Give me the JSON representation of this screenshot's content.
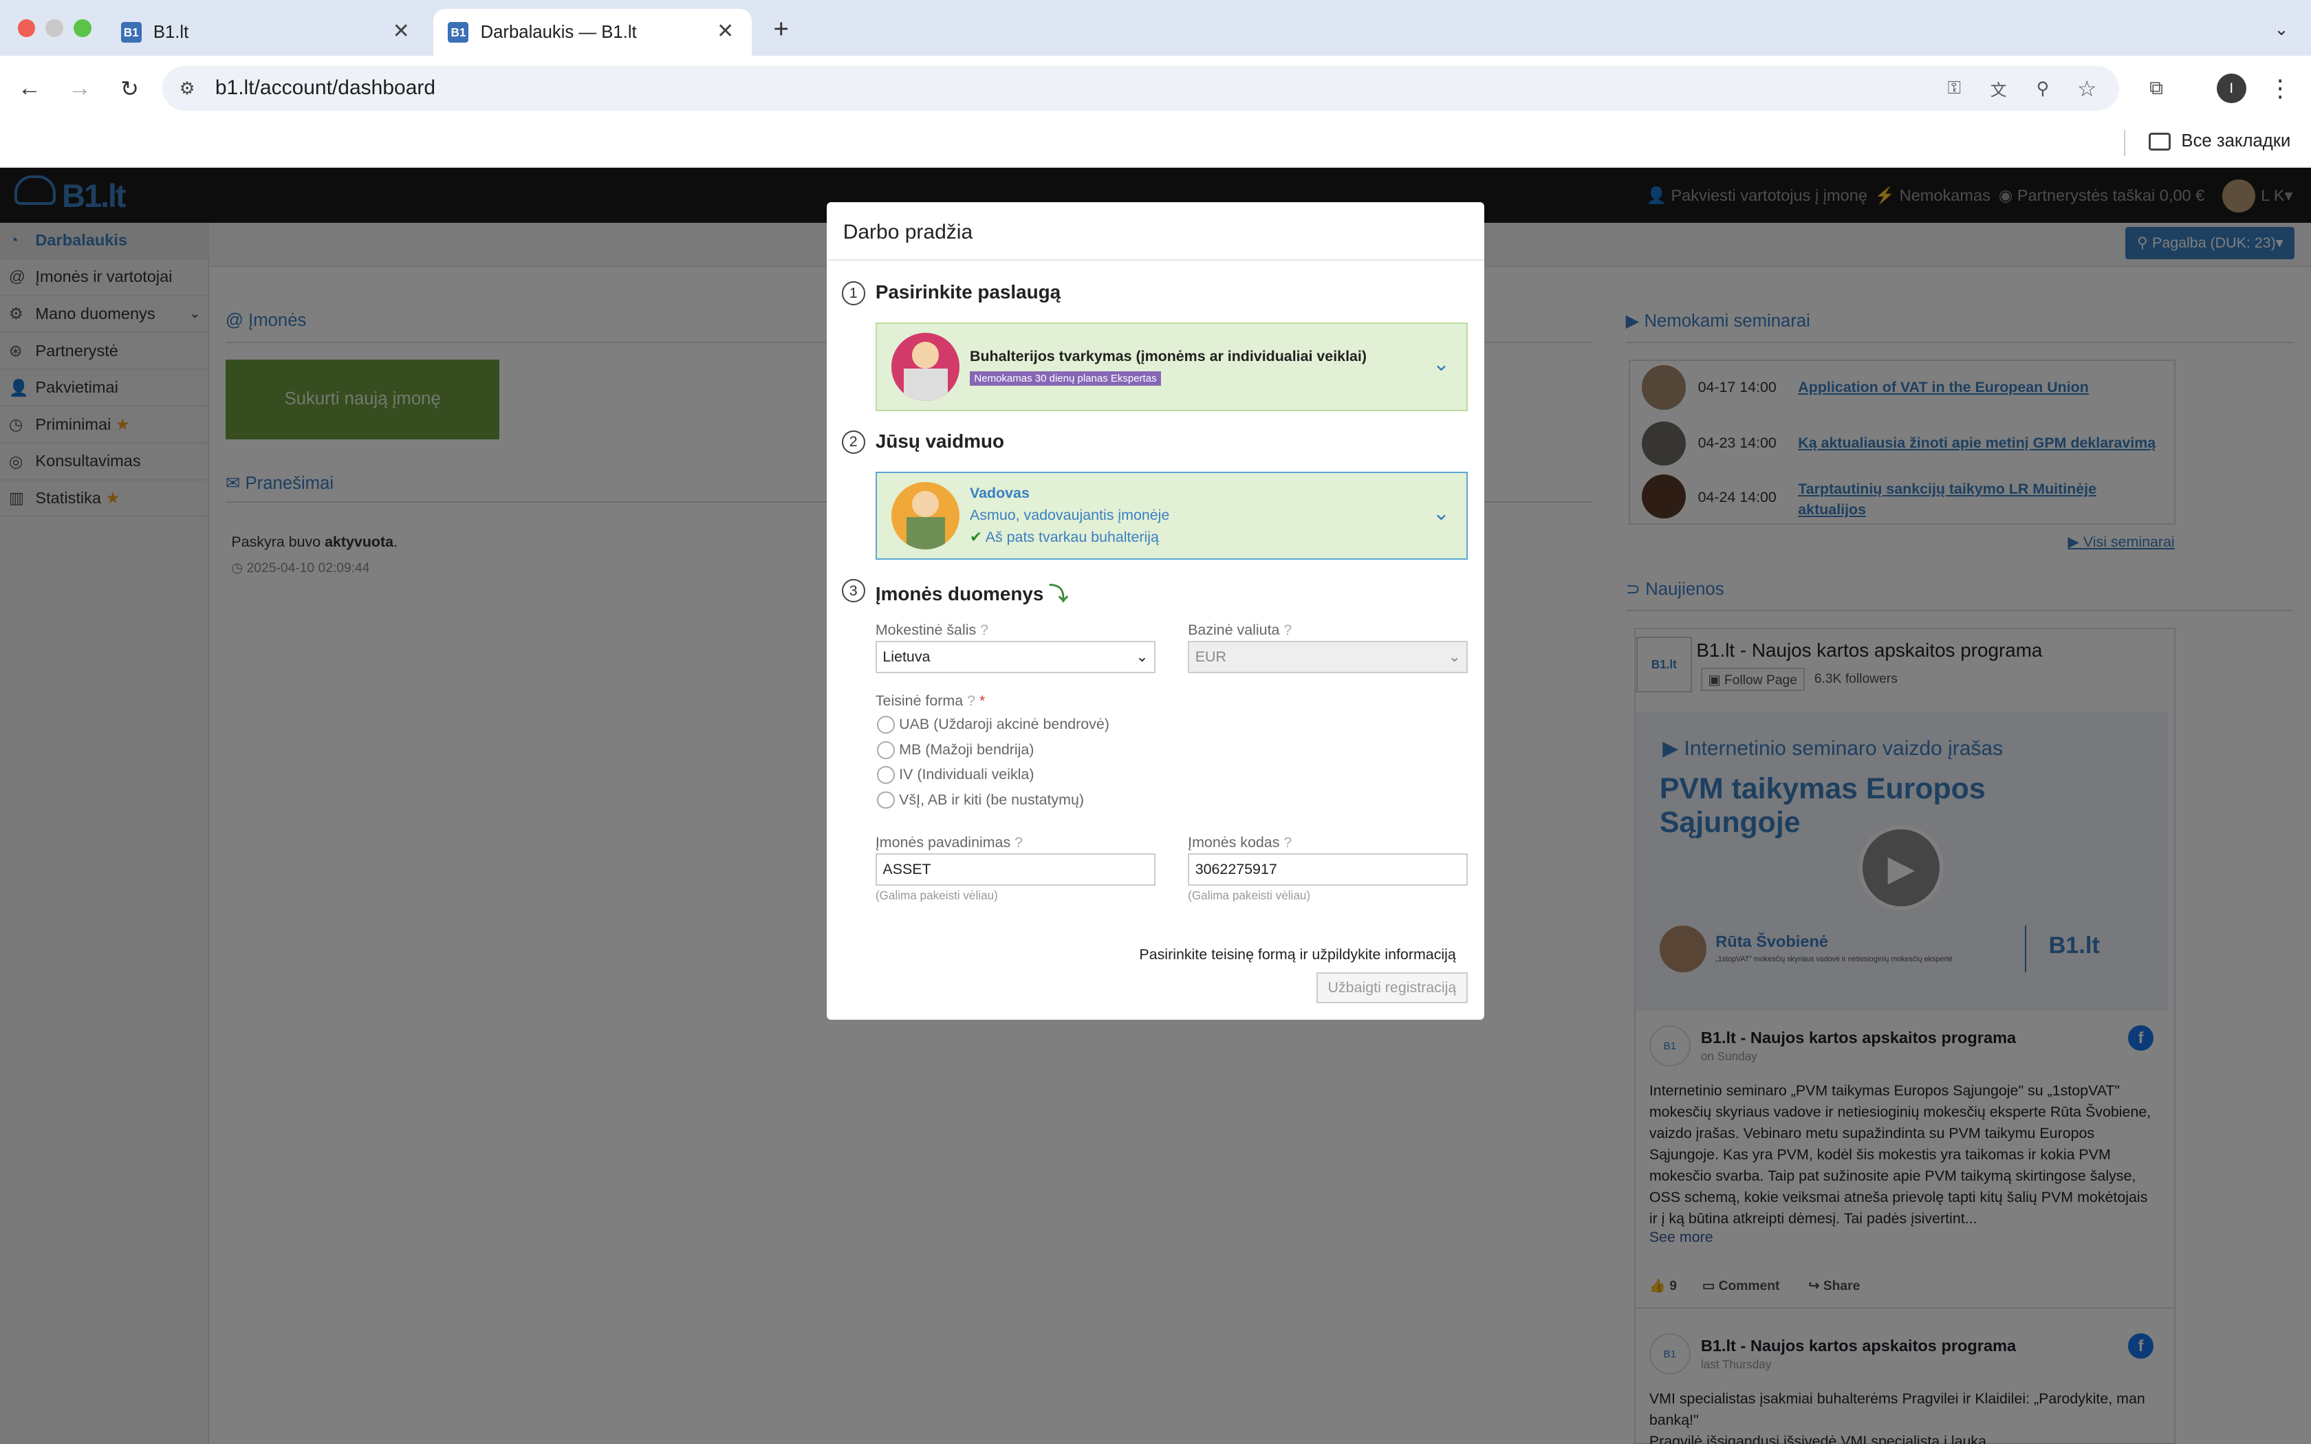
{
  "browser": {
    "tabs": [
      {
        "label": "B1.lt",
        "favicon": "B1"
      },
      {
        "label": "Darbalaukis — B1.lt",
        "favicon": "B1"
      }
    ],
    "url": "b1.lt/account/dashboard",
    "bookmarks_label": "Все закладки",
    "profile_initial": "I"
  },
  "topnav": {
    "logo": "B1.lt",
    "invite": "Pakviesti vartotojus į įmonę",
    "plan": "Nemokamas",
    "points": "Partnerystės taškai 0,00 €",
    "user": "L K",
    "help": "Pagalba (DUK: 23)"
  },
  "sidebar": {
    "items": [
      {
        "label": "Darbalaukis",
        "icon": "dashboard-icon"
      },
      {
        "label": "Įmonės ir vartotojai",
        "icon": "at-icon"
      },
      {
        "label": "Mano duomenys",
        "icon": "gears-icon"
      },
      {
        "label": "Partnerystė",
        "icon": "handshake-icon"
      },
      {
        "label": "Pakvietimai",
        "icon": "user-plus-icon"
      },
      {
        "label": "Priminimai",
        "icon": "clock-icon"
      },
      {
        "label": "Konsultavimas",
        "icon": "globe-icon"
      },
      {
        "label": "Statistika",
        "icon": "bar-chart-icon"
      }
    ]
  },
  "main": {
    "companies_title": "@ Įmonės",
    "create_button": "Sukurti naują įmonę",
    "messages_title": "Pranešimai",
    "message_text": "Paskyra buvo",
    "message_bold": "aktyvuota",
    "message_time": "2025-04-10 02:09:44"
  },
  "seminars": {
    "title": "Nemokami seminarai",
    "rows": [
      {
        "date": "04-17 14:00",
        "title": "Application of VAT in the European Union"
      },
      {
        "date": "04-23 14:00",
        "title": "Ką aktualiausia žinoti apie metinį GPM deklaravimą"
      },
      {
        "date": "04-24 14:00",
        "title": "Tarptautinių sankcijų taikymo LR Muitinėje aktualijos"
      }
    ],
    "all_link": "Visi seminarai"
  },
  "news": {
    "title": "Naujienos",
    "fb_page": "B1.lt - Naujos kartos apskaitos programa",
    "follow": "Follow Page",
    "followers": "6.3K followers",
    "video_caption": "Internetinio seminaro vaizdo įrašas",
    "video_title": "PVM taikymas Europos Sąjungoje",
    "speaker": "Rūta Švobienė",
    "speaker_sub": "„1stopVAT\" mokesčių skyriaus vadovė ir netiesioginių mokesčių ekspertė",
    "video_logo": "B1.lt",
    "post1_author": "B1.lt - Naujos kartos apskaitos programa",
    "post1_time": "on Sunday",
    "post1_text": "Internetinio seminaro „PVM taikymas Europos Sąjungoje\" su „1stopVAT\" mokesčių skyriaus vadove ir netiesioginių mokesčių eksperte Rūta Švobiene, vaizdo įrašas. Vebinaro metu supažindinta su PVM taikymu Europos Sąjungoje. Kas yra PVM, kodėl šis mokestis yra taikomas ir kokia PVM mokesčio svarba. Taip pat sužinosite apie PVM taikymą skirtingose šalyse, OSS schemą, kokie veiksmai atneša prievolę tapti kitų šalių PVM mokėtojais ir į ką būtina atkreipti dėmesį. Tai padės įsivertint...",
    "see_more": "See more",
    "likes": "9",
    "comment": "Comment",
    "share": "Share",
    "post2_author": "B1.lt - Naujos kartos apskaitos programa",
    "post2_time": "last Thursday",
    "post2_text": "VMI specialistas įsakmiai buhalterėms Pragvilei ir Klaidilei: „Parodykite, man banką!\"",
    "post2_text2": "Pragvilė išsigandusi išsivedė VMI specialistą į lauką..."
  },
  "modal": {
    "title": "Darbo pradžia",
    "step1_num": "1",
    "step1_title": "Pasirinkite paslaugą",
    "service_name": "Buhalterijos tvarkymas (įmonėms ar individualiai veiklai)",
    "service_badge": "Nemokamas 30 dienų planas Ekspertas",
    "step2_num": "2",
    "step2_title": "Jūsų vaidmuo",
    "role_name": "Vadovas",
    "role_desc": "Asmuo, vadovaujantis įmonėje",
    "role_check": "Aš pats tvarkau buhalteriją",
    "step3_num": "3",
    "step3_title": "Įmonės duomenys",
    "country_label": "Mokestinė šalis",
    "country_value": "Lietuva",
    "currency_label": "Bazinė valiuta",
    "currency_value": "EUR",
    "legal_label": "Teisinė forma",
    "legal_options": [
      "UAB (Uždaroji akcinė bendrovė)",
      "MB (Mažoji bendrija)",
      "IV (Individuali veikla)",
      "VšĮ, AB ir kiti (be nustatymų)"
    ],
    "name_label": "Įmonės pavadinimas",
    "name_value": "ASSET",
    "code_label": "Įmonės kodas",
    "code_value": "3062275917",
    "hint": "(Galima pakeisti vėliau)",
    "footer_msg": "Pasirinkite teisinę formą ir užpildykite informaciją",
    "finish_button": "Užbaigti registraciją"
  },
  "colors": {
    "accent": "#3a7fc1",
    "green": "#6a9a3f",
    "modal_card": "#e2f0d5",
    "navbar": "#1b1b1b"
  }
}
